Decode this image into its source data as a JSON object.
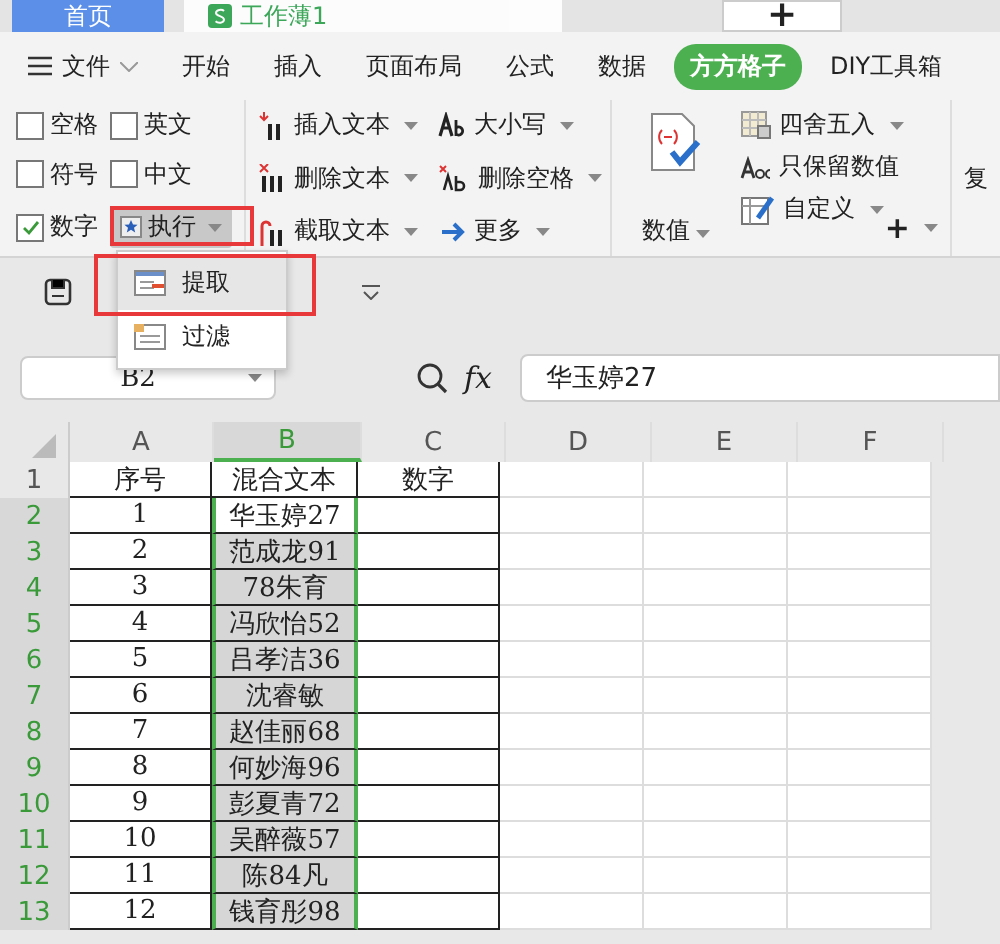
{
  "doc_tabs": [
    {
      "label": "首页",
      "kind": "home",
      "selected": true
    },
    {
      "label": "工作薄1",
      "kind": "sheet",
      "selected": false
    }
  ],
  "new_tab": "+",
  "menu": {
    "file": "文件",
    "items": [
      {
        "label": "开始",
        "selected": false
      },
      {
        "label": "插入",
        "selected": false
      },
      {
        "label": "页面布局",
        "selected": false
      },
      {
        "label": "公式",
        "selected": false
      },
      {
        "label": "数据",
        "selected": false
      },
      {
        "label": "方方格子",
        "selected": true
      },
      {
        "label": "DIY工具箱",
        "selected": false
      }
    ]
  },
  "ribbon": {
    "checkboxes": [
      {
        "label": "空格",
        "checked": false
      },
      {
        "label": "英文",
        "checked": false
      },
      {
        "label": "符号",
        "checked": false
      },
      {
        "label": "中文",
        "checked": false
      },
      {
        "label": "数字",
        "checked": true
      }
    ],
    "execute": "执行",
    "text_tools": [
      {
        "label": "插入文本",
        "kind": "insert"
      },
      {
        "label": "大小写",
        "kind": "case"
      },
      {
        "label": "删除文本",
        "kind": "delete"
      },
      {
        "label": "删除空格",
        "kind": "space"
      },
      {
        "label": "截取文本",
        "kind": "cut"
      },
      {
        "label": "更多",
        "kind": "more"
      }
    ],
    "value_button": "数值",
    "number_tools": [
      {
        "label": "四舍五入",
        "kind": "round",
        "dropdown": true
      },
      {
        "label": "只保留数值",
        "kind": "keep",
        "dropdown": false
      },
      {
        "label": "自定义",
        "kind": "custom",
        "dropdown": true
      }
    ],
    "add_button": "+",
    "cut_label": "复"
  },
  "dropdown": [
    {
      "label": "提取",
      "kind": "extract",
      "selected": true
    },
    {
      "label": "过滤",
      "kind": "filter",
      "selected": false
    }
  ],
  "formula_bar": {
    "name_box": "B2",
    "fx": "fx",
    "value": "华玉婷27"
  },
  "table": {
    "columns": [
      {
        "label": "A",
        "selected": false
      },
      {
        "label": "B",
        "selected": true
      },
      {
        "label": "C",
        "selected": false
      },
      {
        "label": "D",
        "selected": false
      },
      {
        "label": "E",
        "selected": false
      },
      {
        "label": "F",
        "selected": false
      }
    ],
    "rows": [
      {
        "number": "1",
        "selected": false,
        "cells": [
          "序号",
          "混合文本",
          "数字"
        ]
      },
      {
        "number": "2",
        "selected": true,
        "active": true,
        "cells": [
          "1",
          "华玉婷27",
          ""
        ]
      },
      {
        "number": "3",
        "selected": true,
        "cells": [
          "2",
          "范成龙91",
          ""
        ]
      },
      {
        "number": "4",
        "selected": true,
        "cells": [
          "3",
          "78朱育",
          ""
        ]
      },
      {
        "number": "5",
        "selected": true,
        "cells": [
          "4",
          "冯欣怡52",
          ""
        ]
      },
      {
        "number": "6",
        "selected": true,
        "cells": [
          "5",
          "吕孝洁36",
          ""
        ]
      },
      {
        "number": "7",
        "selected": true,
        "cells": [
          "6",
          "沈睿敏",
          ""
        ]
      },
      {
        "number": "8",
        "selected": true,
        "cells": [
          "7",
          "赵佳丽68",
          ""
        ]
      },
      {
        "number": "9",
        "selected": true,
        "cells": [
          "8",
          "何妙海96",
          ""
        ]
      },
      {
        "number": "10",
        "selected": true,
        "cells": [
          "9",
          "彭夏青72",
          ""
        ]
      },
      {
        "number": "11",
        "selected": true,
        "cells": [
          "10",
          "吴醉薇57",
          ""
        ]
      },
      {
        "number": "12",
        "selected": true,
        "cells": [
          "11",
          "陈84凡",
          ""
        ]
      },
      {
        "number": "13",
        "selected": true,
        "cells": [
          "12",
          "钱育彤98",
          ""
        ]
      }
    ]
  }
}
